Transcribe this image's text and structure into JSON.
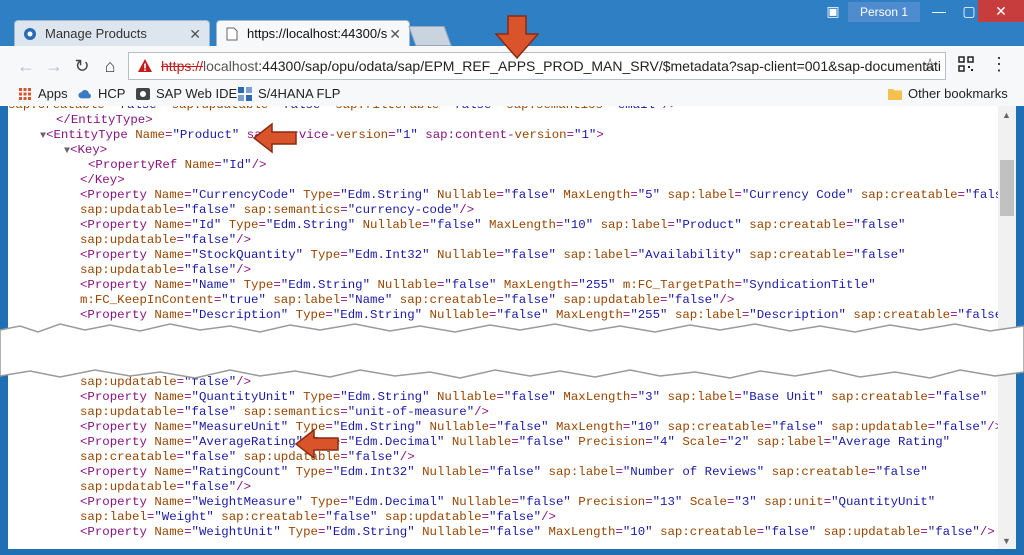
{
  "browser": {
    "tabs": [
      {
        "label": "Manage Products",
        "active": false
      },
      {
        "label": "https://localhost:44300/s",
        "active": true
      }
    ],
    "person": "Person 1",
    "url": {
      "scheme": "https://",
      "host": "localhost",
      "path": ":44300/sap/opu/odata/sap/EPM_REF_APPS_PROD_MAN_SRV/$metadata?sap-client=001&sap-documentati"
    },
    "bookmarks": [
      {
        "label": "Apps",
        "icon": "apps-grid-icon"
      },
      {
        "label": "HCP",
        "icon": "cloud-icon"
      },
      {
        "label": "SAP Web IDE",
        "icon": "webide-icon"
      },
      {
        "label": "S/4HANA FLP",
        "icon": "flp-icon"
      },
      {
        "label": "Other bookmarks",
        "icon": "folder-icon"
      }
    ]
  },
  "xml_top": [
    {
      "indent": 0,
      "text": "sap:creatable=\"false\" sap:updatable=\"false\" sap:filterable=\"false\" sap:semantics=\"email\"/>"
    },
    {
      "indent": 6,
      "text": "</EntityType>"
    },
    {
      "indent": 4,
      "text": "▼<EntityType Name=\"Product\" sap:service-version=\"1\" sap:content-version=\"1\">"
    },
    {
      "indent": 7,
      "text": "▼<Key>"
    },
    {
      "indent": 10,
      "text": "<PropertyRef Name=\"Id\"/>"
    },
    {
      "indent": 9,
      "text": "</Key>"
    },
    {
      "indent": 9,
      "text": "<Property Name=\"CurrencyCode\" Type=\"Edm.String\" Nullable=\"false\" MaxLength=\"5\" sap:label=\"Currency Code\" sap:creatable=\"false\""
    },
    {
      "indent": 9,
      "text": "sap:updatable=\"false\" sap:semantics=\"currency-code\"/>"
    },
    {
      "indent": 9,
      "text": "<Property Name=\"Id\" Type=\"Edm.String\" Nullable=\"false\" MaxLength=\"10\" sap:label=\"Product\" sap:creatable=\"false\""
    },
    {
      "indent": 9,
      "text": "sap:updatable=\"false\"/>"
    },
    {
      "indent": 9,
      "text": "<Property Name=\"StockQuantity\" Type=\"Edm.Int32\" Nullable=\"false\" sap:label=\"Availability\" sap:creatable=\"false\""
    },
    {
      "indent": 9,
      "text": "sap:updatable=\"false\"/>"
    },
    {
      "indent": 9,
      "text": "<Property Name=\"Name\" Type=\"Edm.String\" Nullable=\"false\" MaxLength=\"255\" m:FC_TargetPath=\"SyndicationTitle\""
    },
    {
      "indent": 9,
      "text": "m:FC_KeepInContent=\"true\" sap:label=\"Name\" sap:creatable=\"false\" sap:updatable=\"false\"/>"
    },
    {
      "indent": 9,
      "text": "<Property Name=\"Description\" Type=\"Edm.String\" Nullable=\"false\" MaxLength=\"255\" sap:label=\"Description\" sap:creatable=\"false\""
    }
  ],
  "xml_bottom": [
    {
      "indent": 9,
      "text": "sap:updatable=\"false\"/>"
    },
    {
      "indent": 9,
      "text": "<Property Name=\"QuantityUnit\" Type=\"Edm.String\" Nullable=\"false\" MaxLength=\"3\" sap:label=\"Base Unit\" sap:creatable=\"false\""
    },
    {
      "indent": 9,
      "text": "sap:updatable=\"false\" sap:semantics=\"unit-of-measure\"/>"
    },
    {
      "indent": 9,
      "text": "<Property Name=\"MeasureUnit\" Type=\"Edm.String\" Nullable=\"false\" MaxLength=\"10\" sap:creatable=\"false\" sap:updatable=\"false\"/>"
    },
    {
      "indent": 9,
      "text": "<Property Name=\"AverageRating\" Type=\"Edm.Decimal\" Nullable=\"false\" Precision=\"4\" Scale=\"2\" sap:label=\"Average Rating\""
    },
    {
      "indent": 9,
      "text": "sap:creatable=\"false\" sap:updatable=\"false\"/>"
    },
    {
      "indent": 9,
      "text": "<Property Name=\"RatingCount\" Type=\"Edm.Int32\" Nullable=\"false\" sap:label=\"Number of Reviews\" sap:creatable=\"false\""
    },
    {
      "indent": 9,
      "text": "sap:updatable=\"false\"/>"
    },
    {
      "indent": 9,
      "text": "<Property Name=\"WeightMeasure\" Type=\"Edm.Decimal\" Nullable=\"false\" Precision=\"13\" Scale=\"3\" sap:unit=\"QuantityUnit\""
    },
    {
      "indent": 9,
      "text": "sap:label=\"Weight\" sap:creatable=\"false\" sap:updatable=\"false\"/>"
    },
    {
      "indent": 9,
      "text": "<Property Name=\"WeightUnit\" Type=\"Edm.String\" Nullable=\"false\" MaxLength=\"10\" sap:creatable=\"false\" sap:updatable=\"false\"/>"
    }
  ],
  "colors": {
    "arrow": "#d9542b",
    "accent": "#2f7fc4"
  }
}
